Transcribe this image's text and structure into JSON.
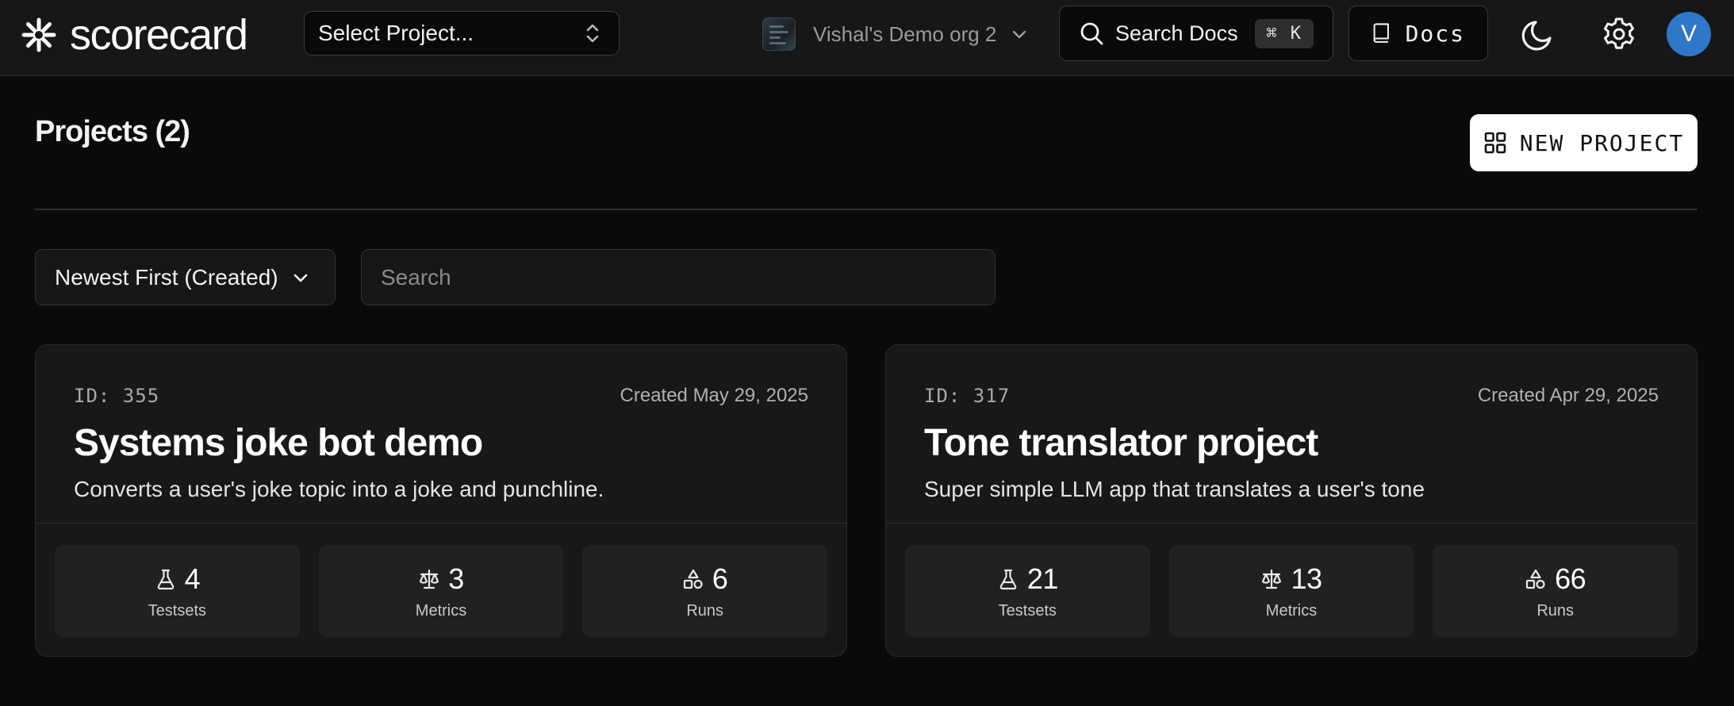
{
  "header": {
    "logo_text": "scorecard",
    "project_select_placeholder": "Select Project...",
    "org_name": "Vishal's Demo org 2",
    "search_docs_label": "Search Docs",
    "search_shortcut": "⌘ K",
    "docs_label": "Docs",
    "user_initial": "V",
    "avatar_color": "#2e77c9"
  },
  "page": {
    "title": "Projects (2)",
    "new_project_label": "NEW PROJECT"
  },
  "filters": {
    "sort_label": "Newest First (Created)",
    "search_placeholder": "Search"
  },
  "projects": [
    {
      "id_label": "ID: 355",
      "created": "Created May 29, 2025",
      "title": "Systems joke bot demo",
      "description": "Converts a user's joke topic into a joke and punchline.",
      "stats": [
        {
          "icon": "flask-icon",
          "value": "4",
          "label": "Testsets"
        },
        {
          "icon": "scale-icon",
          "value": "3",
          "label": "Metrics"
        },
        {
          "icon": "shapes-icon",
          "value": "6",
          "label": "Runs"
        }
      ]
    },
    {
      "id_label": "ID: 317",
      "created": "Created Apr 29, 2025",
      "title": "Tone translator project",
      "description": "Super simple LLM app that translates a user's tone",
      "stats": [
        {
          "icon": "flask-icon",
          "value": "21",
          "label": "Testsets"
        },
        {
          "icon": "scale-icon",
          "value": "13",
          "label": "Metrics"
        },
        {
          "icon": "shapes-icon",
          "value": "66",
          "label": "Runs"
        }
      ]
    }
  ]
}
